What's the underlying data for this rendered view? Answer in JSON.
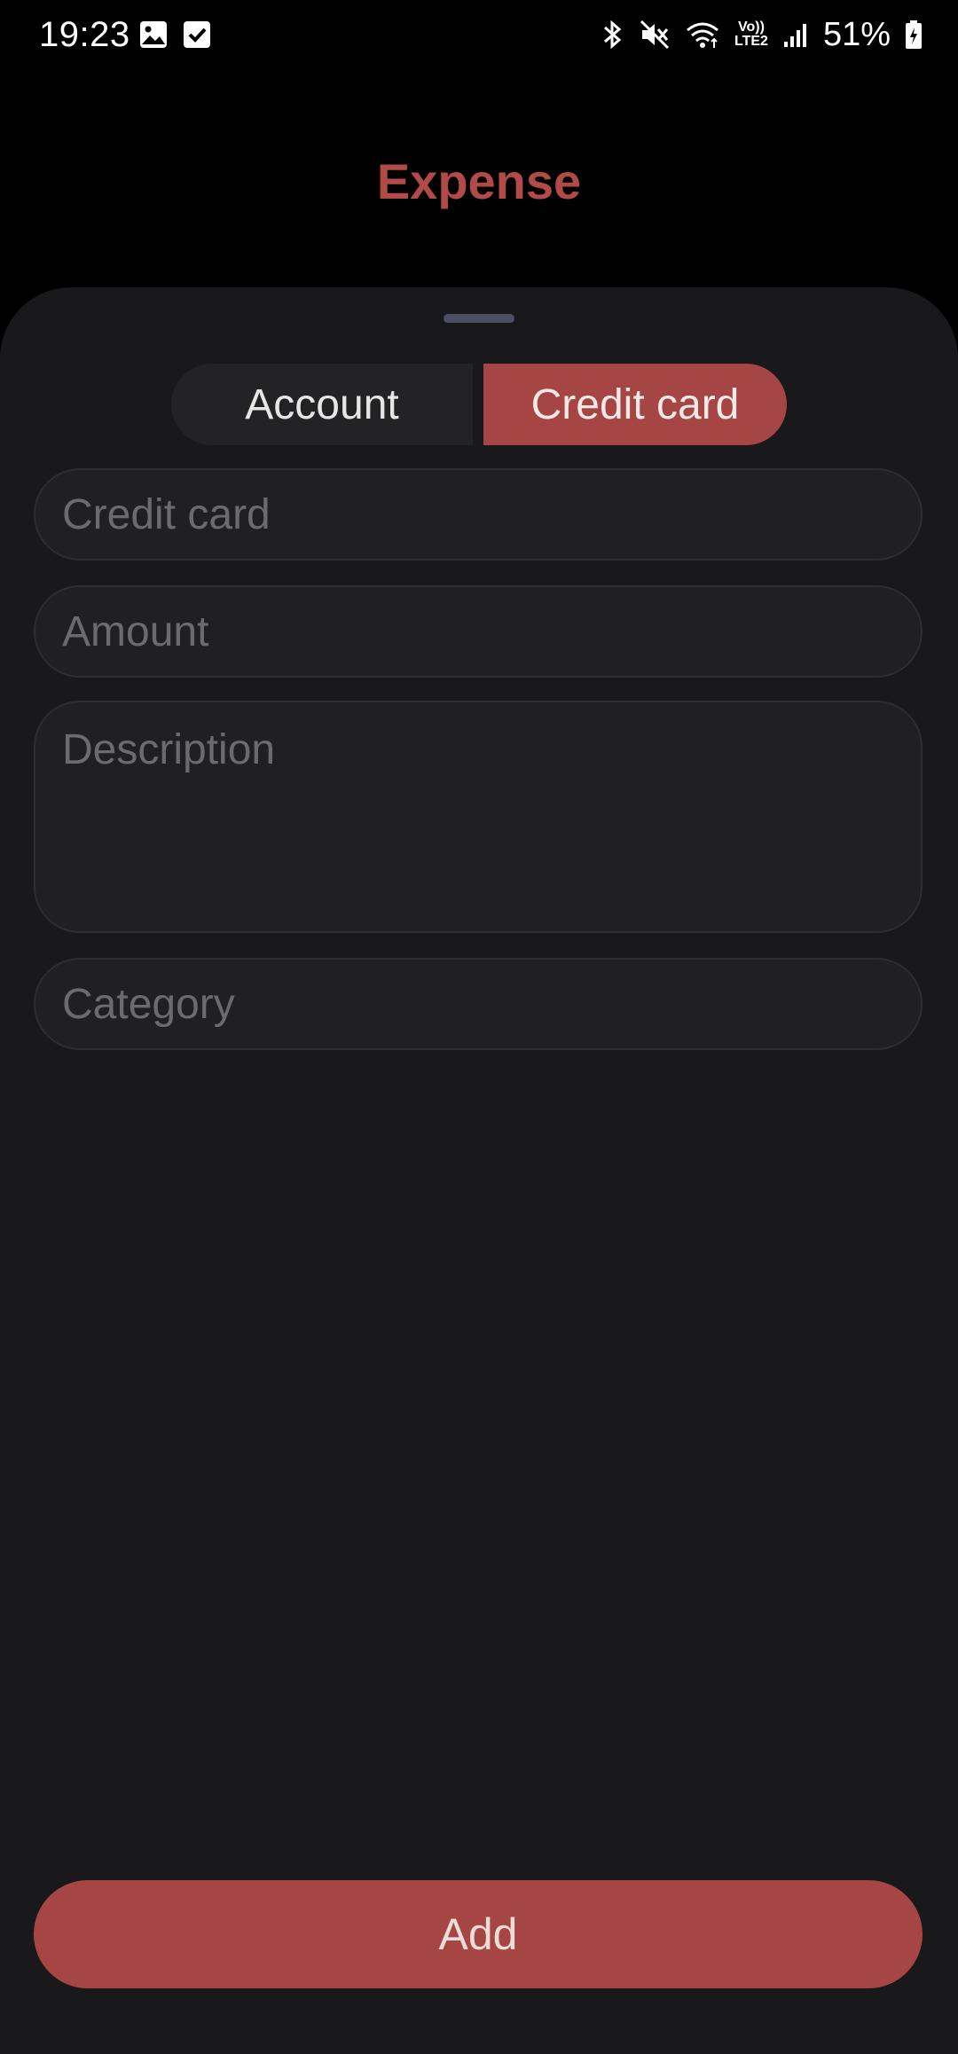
{
  "status_bar": {
    "time": "19:23",
    "battery": "51%",
    "lte_label": "LTE2",
    "volte_label": "Vo))",
    "left_icons": [
      "gallery-icon",
      "checkbox-icon"
    ],
    "right_icons": [
      "bluetooth-icon",
      "mute-icon",
      "wifi-icon",
      "volte-lte-icon",
      "signal-icon",
      "battery-charging-icon"
    ]
  },
  "header": {
    "title": "Expense"
  },
  "segmented": {
    "account_label": "Account",
    "credit_card_label": "Credit card",
    "selected": "Credit card"
  },
  "form": {
    "credit_card_placeholder": "Credit card",
    "amount_placeholder": "Amount",
    "description_placeholder": "Description",
    "category_placeholder": "Category"
  },
  "actions": {
    "add_label": "Add"
  },
  "colors": {
    "accent": "#a64644",
    "title": "#b24a47",
    "sheet_background": "#19191b",
    "field_background": "#202022",
    "placeholder": "#6b6b6e"
  }
}
